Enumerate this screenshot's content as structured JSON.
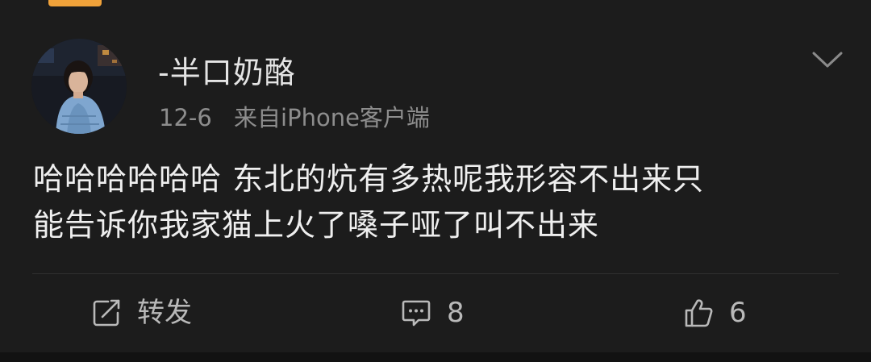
{
  "post": {
    "author": {
      "name": "-半口奶酪",
      "avatar_icon": "user-avatar-photo"
    },
    "date": "12-6",
    "source": "来自iPhone客户端",
    "content_lines": [
      "哈哈哈哈哈哈 东北的炕有多热呢我形容不出来只",
      "能告诉你我家猫上火了嗓子哑了叫不出来"
    ],
    "menu_icon": "chevron-down-icon"
  },
  "actions": {
    "forward": {
      "label": "转发",
      "icon": "share-icon"
    },
    "comment": {
      "count": "8",
      "icon": "comment-icon"
    },
    "like": {
      "count": "6",
      "icon": "thumbs-up-icon"
    }
  },
  "colors": {
    "background": "#1c1c1c",
    "text_primary": "#efefef",
    "text_secondary": "#8d8d8d",
    "accent": "#f0a23a"
  }
}
